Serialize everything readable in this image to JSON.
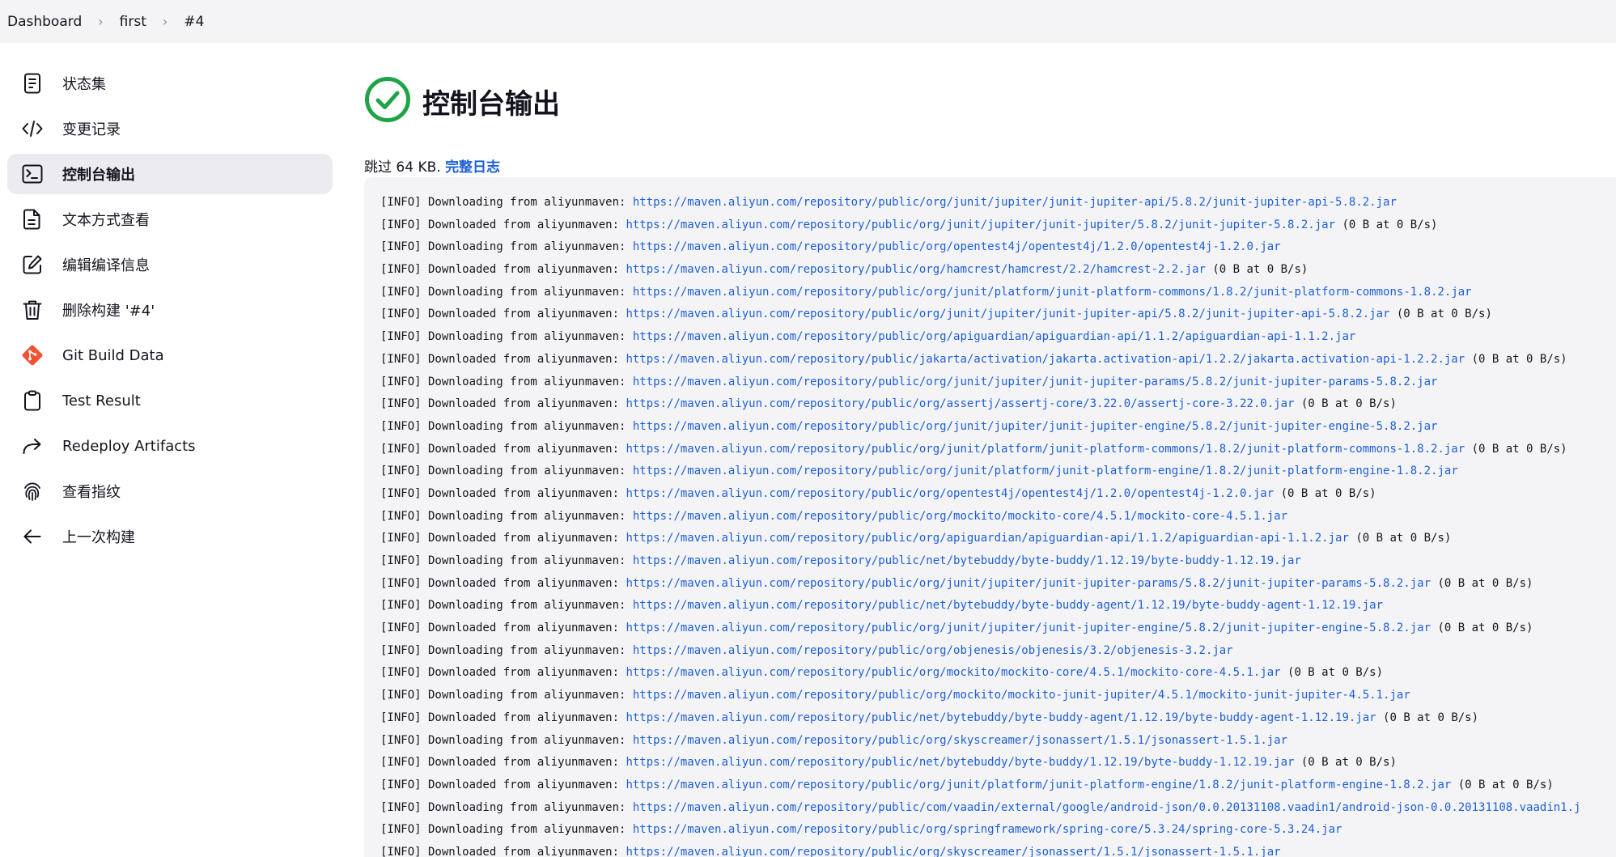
{
  "breadcrumb": [
    "Dashboard",
    "first",
    "#4"
  ],
  "sidebar": {
    "items": [
      {
        "label": "状态集",
        "icon": "document-icon",
        "active": false
      },
      {
        "label": "变更记录",
        "icon": "code-icon",
        "active": false
      },
      {
        "label": "控制台输出",
        "icon": "terminal-icon",
        "active": true
      },
      {
        "label": "文本方式查看",
        "icon": "text-file-icon",
        "active": false
      },
      {
        "label": "编辑编译信息",
        "icon": "edit-icon",
        "active": false
      },
      {
        "label": "删除构建 '#4'",
        "icon": "trash-icon",
        "active": false
      },
      {
        "label": "Git Build Data",
        "icon": "git-icon",
        "active": false
      },
      {
        "label": "Test Result",
        "icon": "clipboard-icon",
        "active": false
      },
      {
        "label": "Redeploy Artifacts",
        "icon": "redeploy-icon",
        "active": false
      },
      {
        "label": "查看指纹",
        "icon": "fingerprint-icon",
        "active": false
      },
      {
        "label": "上一次构建",
        "icon": "arrow-left-icon",
        "active": false
      }
    ]
  },
  "page": {
    "title": "控制台输出",
    "status_icon": "success-check-icon",
    "skip_text": "跳过 64 KB.",
    "full_log_label": "完整日志"
  },
  "colors": {
    "accent": "#1d5fd6",
    "success": "#1ea446",
    "git": "#f05133"
  },
  "console": {
    "lines": [
      {
        "prefix": "[INFO] Downloading from aliyunmaven: ",
        "url": "https://maven.aliyun.com/repository/public/org/junit/jupiter/junit-jupiter-api/5.8.2/junit-jupiter-api-5.8.2.jar",
        "suffix": ""
      },
      {
        "prefix": "[INFO] Downloaded from aliyunmaven: ",
        "url": "https://maven.aliyun.com/repository/public/org/junit/jupiter/junit-jupiter/5.8.2/junit-jupiter-5.8.2.jar",
        "suffix": " (0 B at 0 B/s)"
      },
      {
        "prefix": "[INFO] Downloading from aliyunmaven: ",
        "url": "https://maven.aliyun.com/repository/public/org/opentest4j/opentest4j/1.2.0/opentest4j-1.2.0.jar",
        "suffix": ""
      },
      {
        "prefix": "[INFO] Downloaded from aliyunmaven: ",
        "url": "https://maven.aliyun.com/repository/public/org/hamcrest/hamcrest/2.2/hamcrest-2.2.jar",
        "suffix": " (0 B at 0 B/s)"
      },
      {
        "prefix": "[INFO] Downloading from aliyunmaven: ",
        "url": "https://maven.aliyun.com/repository/public/org/junit/platform/junit-platform-commons/1.8.2/junit-platform-commons-1.8.2.jar",
        "suffix": ""
      },
      {
        "prefix": "[INFO] Downloaded from aliyunmaven: ",
        "url": "https://maven.aliyun.com/repository/public/org/junit/jupiter/junit-jupiter-api/5.8.2/junit-jupiter-api-5.8.2.jar",
        "suffix": " (0 B at 0 B/s)"
      },
      {
        "prefix": "[INFO] Downloading from aliyunmaven: ",
        "url": "https://maven.aliyun.com/repository/public/org/apiguardian/apiguardian-api/1.1.2/apiguardian-api-1.1.2.jar",
        "suffix": ""
      },
      {
        "prefix": "[INFO] Downloaded from aliyunmaven: ",
        "url": "https://maven.aliyun.com/repository/public/jakarta/activation/jakarta.activation-api/1.2.2/jakarta.activation-api-1.2.2.jar",
        "suffix": " (0 B at 0 B/s)"
      },
      {
        "prefix": "[INFO] Downloading from aliyunmaven: ",
        "url": "https://maven.aliyun.com/repository/public/org/junit/jupiter/junit-jupiter-params/5.8.2/junit-jupiter-params-5.8.2.jar",
        "suffix": ""
      },
      {
        "prefix": "[INFO] Downloaded from aliyunmaven: ",
        "url": "https://maven.aliyun.com/repository/public/org/assertj/assertj-core/3.22.0/assertj-core-3.22.0.jar",
        "suffix": " (0 B at 0 B/s)"
      },
      {
        "prefix": "[INFO] Downloading from aliyunmaven: ",
        "url": "https://maven.aliyun.com/repository/public/org/junit/jupiter/junit-jupiter-engine/5.8.2/junit-jupiter-engine-5.8.2.jar",
        "suffix": ""
      },
      {
        "prefix": "[INFO] Downloaded from aliyunmaven: ",
        "url": "https://maven.aliyun.com/repository/public/org/junit/platform/junit-platform-commons/1.8.2/junit-platform-commons-1.8.2.jar",
        "suffix": " (0 B at 0 B/s)"
      },
      {
        "prefix": "[INFO] Downloading from aliyunmaven: ",
        "url": "https://maven.aliyun.com/repository/public/org/junit/platform/junit-platform-engine/1.8.2/junit-platform-engine-1.8.2.jar",
        "suffix": ""
      },
      {
        "prefix": "[INFO] Downloaded from aliyunmaven: ",
        "url": "https://maven.aliyun.com/repository/public/org/opentest4j/opentest4j/1.2.0/opentest4j-1.2.0.jar",
        "suffix": " (0 B at 0 B/s)"
      },
      {
        "prefix": "[INFO] Downloading from aliyunmaven: ",
        "url": "https://maven.aliyun.com/repository/public/org/mockito/mockito-core/4.5.1/mockito-core-4.5.1.jar",
        "suffix": ""
      },
      {
        "prefix": "[INFO] Downloaded from aliyunmaven: ",
        "url": "https://maven.aliyun.com/repository/public/org/apiguardian/apiguardian-api/1.1.2/apiguardian-api-1.1.2.jar",
        "suffix": " (0 B at 0 B/s)"
      },
      {
        "prefix": "[INFO] Downloading from aliyunmaven: ",
        "url": "https://maven.aliyun.com/repository/public/net/bytebuddy/byte-buddy/1.12.19/byte-buddy-1.12.19.jar",
        "suffix": ""
      },
      {
        "prefix": "[INFO] Downloaded from aliyunmaven: ",
        "url": "https://maven.aliyun.com/repository/public/org/junit/jupiter/junit-jupiter-params/5.8.2/junit-jupiter-params-5.8.2.jar",
        "suffix": " (0 B at 0 B/s)"
      },
      {
        "prefix": "[INFO] Downloading from aliyunmaven: ",
        "url": "https://maven.aliyun.com/repository/public/net/bytebuddy/byte-buddy-agent/1.12.19/byte-buddy-agent-1.12.19.jar",
        "suffix": ""
      },
      {
        "prefix": "[INFO] Downloaded from aliyunmaven: ",
        "url": "https://maven.aliyun.com/repository/public/org/junit/jupiter/junit-jupiter-engine/5.8.2/junit-jupiter-engine-5.8.2.jar",
        "suffix": " (0 B at 0 B/s)"
      },
      {
        "prefix": "[INFO] Downloading from aliyunmaven: ",
        "url": "https://maven.aliyun.com/repository/public/org/objenesis/objenesis/3.2/objenesis-3.2.jar",
        "suffix": ""
      },
      {
        "prefix": "[INFO] Downloaded from aliyunmaven: ",
        "url": "https://maven.aliyun.com/repository/public/org/mockito/mockito-core/4.5.1/mockito-core-4.5.1.jar",
        "suffix": " (0 B at 0 B/s)"
      },
      {
        "prefix": "[INFO] Downloading from aliyunmaven: ",
        "url": "https://maven.aliyun.com/repository/public/org/mockito/mockito-junit-jupiter/4.5.1/mockito-junit-jupiter-4.5.1.jar",
        "suffix": ""
      },
      {
        "prefix": "[INFO] Downloaded from aliyunmaven: ",
        "url": "https://maven.aliyun.com/repository/public/net/bytebuddy/byte-buddy-agent/1.12.19/byte-buddy-agent-1.12.19.jar",
        "suffix": " (0 B at 0 B/s)"
      },
      {
        "prefix": "[INFO] Downloading from aliyunmaven: ",
        "url": "https://maven.aliyun.com/repository/public/org/skyscreamer/jsonassert/1.5.1/jsonassert-1.5.1.jar",
        "suffix": ""
      },
      {
        "prefix": "[INFO] Downloaded from aliyunmaven: ",
        "url": "https://maven.aliyun.com/repository/public/net/bytebuddy/byte-buddy/1.12.19/byte-buddy-1.12.19.jar",
        "suffix": " (0 B at 0 B/s)"
      },
      {
        "prefix": "[INFO] Downloaded from aliyunmaven: ",
        "url": "https://maven.aliyun.com/repository/public/org/junit/platform/junit-platform-engine/1.8.2/junit-platform-engine-1.8.2.jar",
        "suffix": " (0 B at 0 B/s)"
      },
      {
        "prefix": "[INFO] Downloading from aliyunmaven: ",
        "url": "https://maven.aliyun.com/repository/public/com/vaadin/external/google/android-json/0.0.20131108.vaadin1/android-json-0.0.20131108.vaadin1.j",
        "suffix": ""
      },
      {
        "prefix": "[INFO] Downloading from aliyunmaven: ",
        "url": "https://maven.aliyun.com/repository/public/org/springframework/spring-core/5.3.24/spring-core-5.3.24.jar",
        "suffix": ""
      },
      {
        "prefix": "[INFO] Downloaded from aliyunmaven: ",
        "url": "https://maven.aliyun.com/repository/public/org/skyscreamer/jsonassert/1.5.1/jsonassert-1.5.1.jar",
        "suffix": ""
      }
    ]
  }
}
